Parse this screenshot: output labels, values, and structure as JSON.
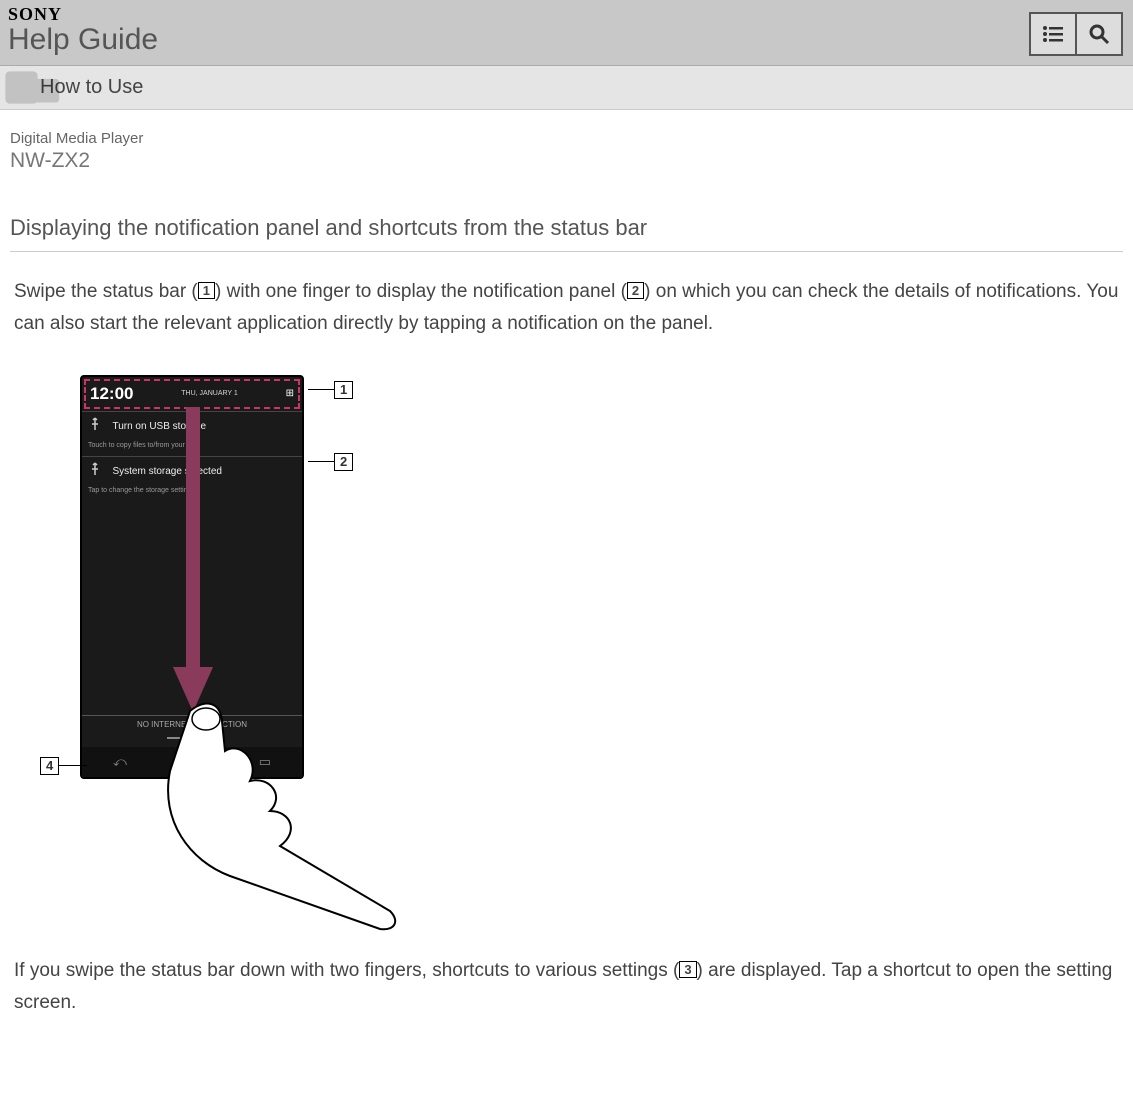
{
  "header": {
    "brand": "SONY",
    "title": "Help Guide"
  },
  "breadcrumb": {
    "label": "How to Use"
  },
  "product": {
    "type": "Digital Media Player",
    "model": "NW-ZX2"
  },
  "page": {
    "title": "Displaying the notification panel and shortcuts from the status bar"
  },
  "para1": {
    "a": "Swipe the status bar (",
    "ref1": "1",
    "b": ") with one finger to display the notification panel (",
    "ref2": "2",
    "c": ") on which you can check the details of notifications. You can also start the relevant application directly by tapping a notification on the panel."
  },
  "para2": {
    "a": "If you swipe the status bar down with two fingers, shortcuts to various settings (",
    "ref3": "3",
    "b": ") are displayed. Tap a shortcut to open the setting screen."
  },
  "figure": {
    "callout1": "1",
    "callout2": "2",
    "callout4": "4",
    "status_time": "12:00",
    "status_date": "THU, JANUARY 1",
    "notif1_title": "Turn on USB storage",
    "notif1_sub": "Touch to copy files to/from your co..",
    "notif2_title": "System storage selected",
    "notif2_sub": "Tap to change the storage setting.",
    "no_conn": "NO INTERNET CONNECTION"
  }
}
